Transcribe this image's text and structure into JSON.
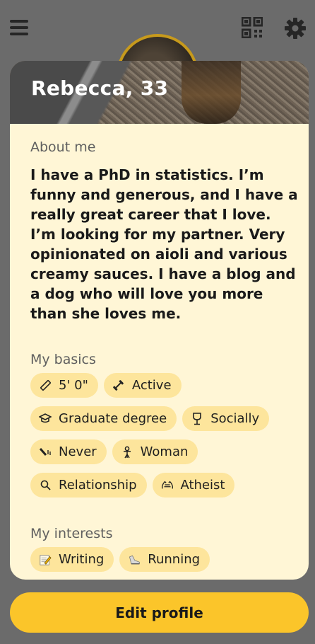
{
  "profile": {
    "name_age": "Rebecca, 33",
    "about_label": "About me",
    "about_text": "I have a PhD in statistics. I’m funny and generous, and I have a really great career that I love. I’m looking for my partner. Very opinionated on aioli and various creamy sauces. I have a blog and a dog who will love you more than she loves me.",
    "basics_label": "My basics",
    "basics": [
      {
        "icon": "ruler-icon",
        "label": "5' 0\""
      },
      {
        "icon": "dumbbell-icon",
        "label": "Active"
      },
      {
        "icon": "graduation-cap-icon",
        "label": "Graduate degree"
      },
      {
        "icon": "wine-glass-icon",
        "label": "Socially"
      },
      {
        "icon": "smoking-icon",
        "label": "Never"
      },
      {
        "icon": "gender-icon",
        "label": "Woman"
      },
      {
        "icon": "search-icon",
        "label": "Relationship"
      },
      {
        "icon": "praying-hands-icon",
        "label": "Atheist"
      }
    ],
    "interests_label": "My interests",
    "interests": [
      {
        "icon": "memo-icon",
        "label": "Writing"
      },
      {
        "icon": "running-shoe-icon",
        "label": "Running"
      }
    ]
  },
  "actions": {
    "edit_profile": "Edit profile"
  },
  "colors": {
    "accent": "#fbc52a",
    "chip": "#fde59c",
    "card": "#fff6d6"
  }
}
